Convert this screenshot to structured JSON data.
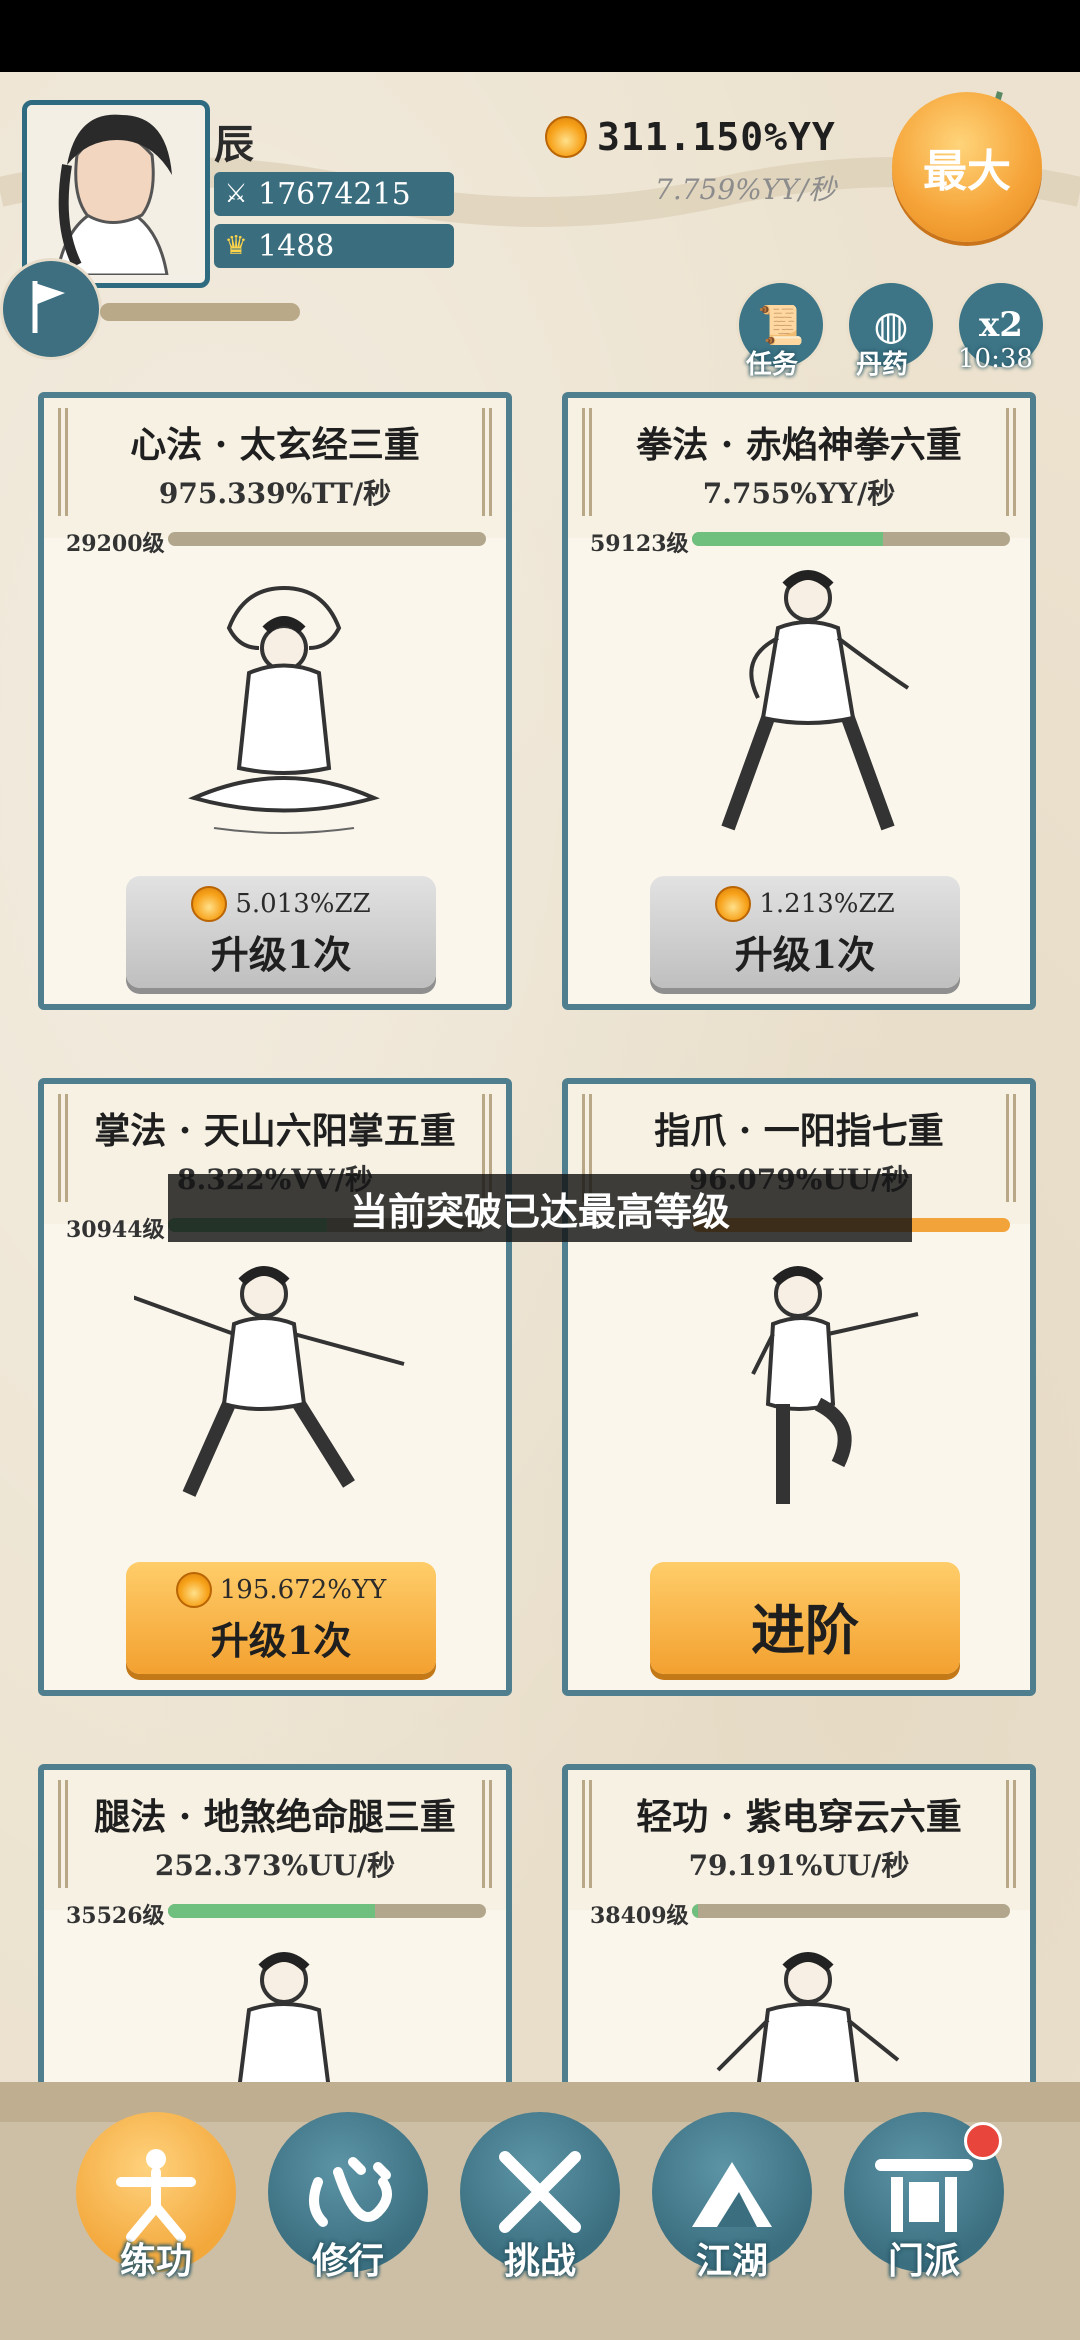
{
  "player": {
    "name": "辰",
    "power": "17674215",
    "gold": "1488"
  },
  "currency": {
    "total": "311.150%YY",
    "rate": "7.759%YY/秒",
    "max_label": "最大"
  },
  "actions": {
    "quest_label": "任务",
    "pill_label": "丹药",
    "x2_label": "x2",
    "timer": "10:38"
  },
  "cards": [
    {
      "name": "心法 · 太玄经三重",
      "rate": "975.339%TT/秒",
      "level": "29200级",
      "progress": 1.0,
      "cost": "5.013%ZZ",
      "button": "升级1次",
      "state": "gray"
    },
    {
      "name": "拳法 · 赤焰神拳六重",
      "rate": "7.755%YY/秒",
      "level": "59123级",
      "progress": 0.6,
      "cost": "1.213%ZZ",
      "button": "升级1次",
      "state": "gray"
    },
    {
      "name": "掌法 · 天山六阳掌五重",
      "rate": "8.322%VV/秒",
      "level": "30944级",
      "progress": 0.5,
      "cost": "195.672%YY",
      "button": "升级1次",
      "state": "orange"
    },
    {
      "name": "指爪 · 一阳指七重",
      "rate": "96.079%UU/秒",
      "level": "",
      "progress": 1.0,
      "cost": "",
      "button": "进阶",
      "state": "advance"
    },
    {
      "name": "腿法 · 地煞绝命腿三重",
      "rate": "252.373%UU/秒",
      "level": "35526级",
      "progress": 0.65,
      "cost": "",
      "button": "",
      "state": "partial"
    },
    {
      "name": "轻功 · 紫电穿云六重",
      "rate": "79.191%UU/秒",
      "level": "38409级",
      "progress": 0.02,
      "cost": "",
      "button": "",
      "state": "partial"
    }
  ],
  "toast": "当前突破已达最高等级",
  "nav": {
    "items": [
      {
        "label": "练功",
        "icon": "practice-icon",
        "active": true
      },
      {
        "label": "修行",
        "icon": "heart-icon",
        "active": false
      },
      {
        "label": "挑战",
        "icon": "swords-icon",
        "active": false
      },
      {
        "label": "江湖",
        "icon": "mountain-icon",
        "active": false
      },
      {
        "label": "门派",
        "icon": "gate-icon",
        "active": false
      }
    ]
  },
  "colors": {
    "teal": "#3d7587",
    "orange": "#f3a83c",
    "paper": "#ece2cf",
    "progress_green": "#6fbf7e"
  }
}
